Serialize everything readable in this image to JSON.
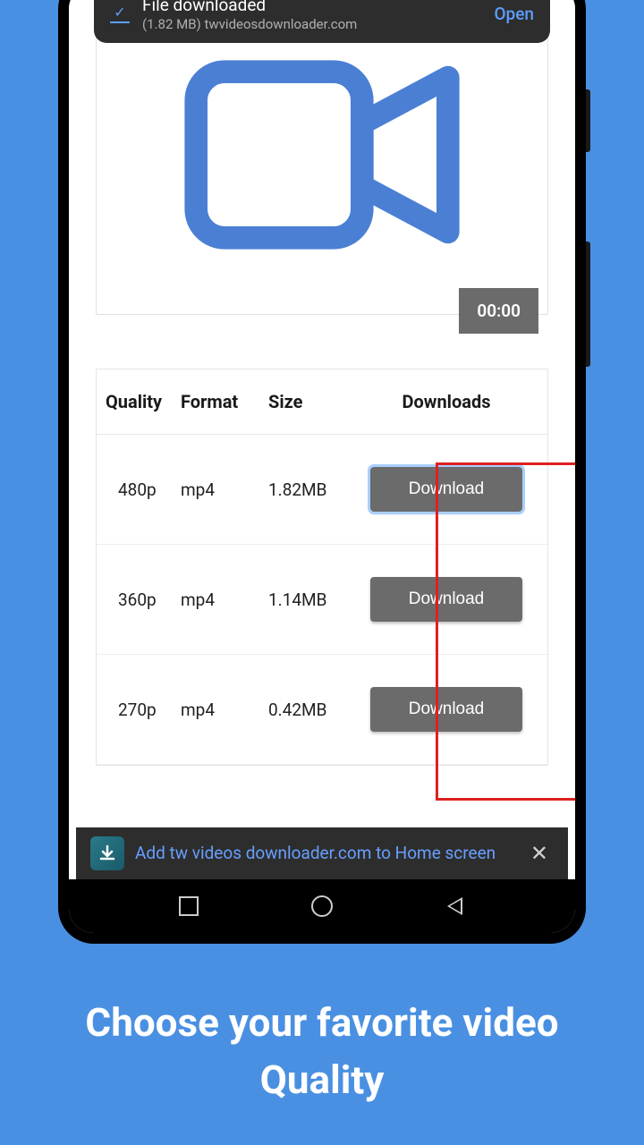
{
  "notification": {
    "title": "File downloaded",
    "subtitle": "(1.82 MB) twvideosdownloader.com",
    "action": "Open"
  },
  "video": {
    "duration": "00:00"
  },
  "table": {
    "headers": {
      "quality": "Quality",
      "format": "Format",
      "size": "Size",
      "downloads": "Downloads"
    },
    "rows": [
      {
        "quality": "480p",
        "format": "mp4",
        "size": "1.82MB",
        "button": "Download"
      },
      {
        "quality": "360p",
        "format": "mp4",
        "size": "1.14MB",
        "button": "Download"
      },
      {
        "quality": "270p",
        "format": "mp4",
        "size": "0.42MB",
        "button": "Download"
      }
    ]
  },
  "prompt": {
    "text": "Add tw videos downloader.com to Home screen"
  },
  "caption": "Choose your favorite video Quality"
}
